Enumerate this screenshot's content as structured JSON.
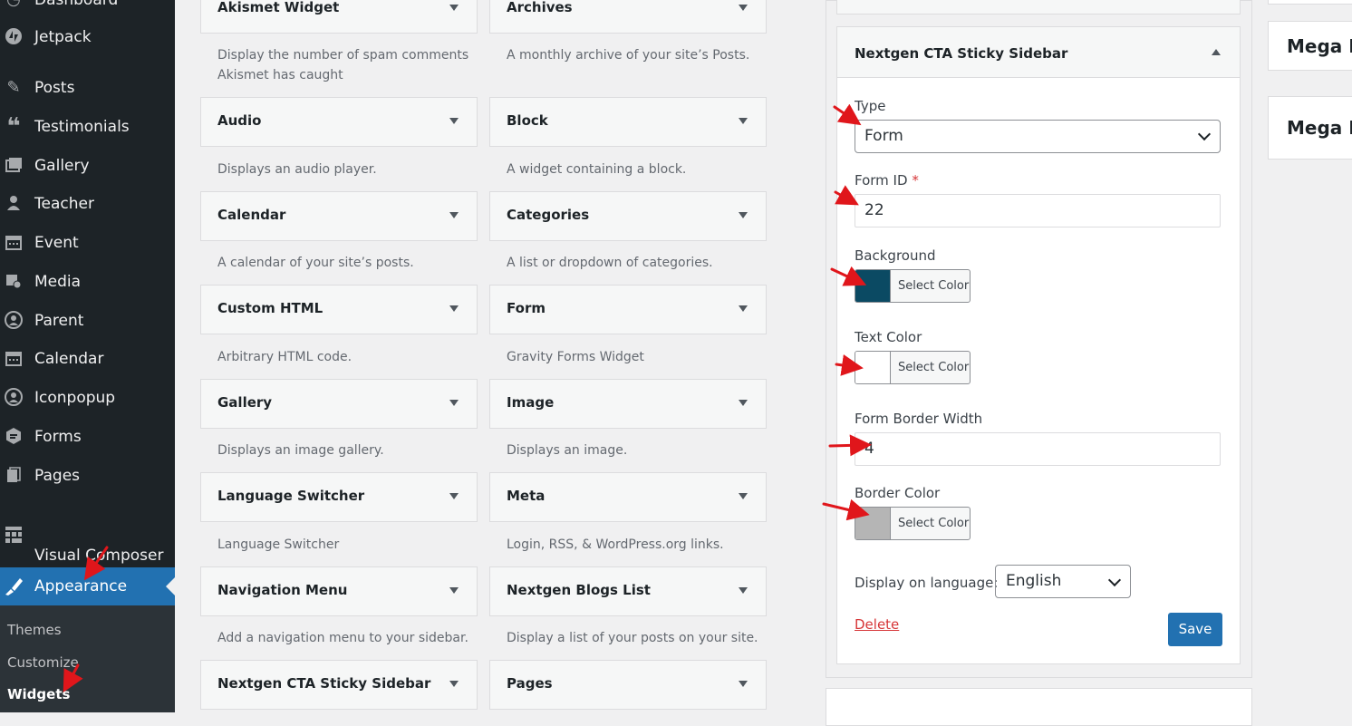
{
  "sidebar": {
    "items": [
      {
        "label": "Dashboard",
        "icon": "dashboard-icon"
      },
      {
        "label": "Jetpack",
        "icon": "jetpack-icon"
      },
      {
        "label": "Posts",
        "icon": "pin-icon"
      },
      {
        "label": "Testimonials",
        "icon": "quote-icon"
      },
      {
        "label": "Gallery",
        "icon": "gallery-icon"
      },
      {
        "label": "Teacher",
        "icon": "user-icon"
      },
      {
        "label": "Event",
        "icon": "calendar-icon"
      },
      {
        "label": "Media",
        "icon": "media-icon"
      },
      {
        "label": "Parent",
        "icon": "user-circle-icon"
      },
      {
        "label": "Calendar",
        "icon": "calendar-icon"
      },
      {
        "label": "Iconpopup",
        "icon": "user-circle-icon"
      },
      {
        "label": "Forms",
        "icon": "forms-icon"
      },
      {
        "label": "Pages",
        "icon": "pages-icon"
      },
      {
        "label": "Visual Composer\nContent",
        "icon": "grid-icon"
      },
      {
        "label": "Appearance",
        "icon": "brush-icon"
      }
    ],
    "submenu": [
      "Themes",
      "Customize",
      "Widgets"
    ]
  },
  "widgets": [
    {
      "title": "Akismet Widget",
      "desc": "Display the number of spam comments Akismet has caught"
    },
    {
      "title": "Archives",
      "desc": "A monthly archive of your site’s Posts."
    },
    {
      "title": "Audio",
      "desc": "Displays an audio player."
    },
    {
      "title": "Block",
      "desc": "A widget containing a block."
    },
    {
      "title": "Calendar",
      "desc": "A calendar of your site’s posts."
    },
    {
      "title": "Categories",
      "desc": "A list or dropdown of categories."
    },
    {
      "title": "Custom HTML",
      "desc": "Arbitrary HTML code."
    },
    {
      "title": "Form",
      "desc": "Gravity Forms Widget"
    },
    {
      "title": "Gallery",
      "desc": "Displays an image gallery."
    },
    {
      "title": "Image",
      "desc": "Displays an image."
    },
    {
      "title": "Language Switcher",
      "desc": "Language Switcher"
    },
    {
      "title": "Meta",
      "desc": "Login, RSS, & WordPress.org links."
    },
    {
      "title": "Navigation Menu",
      "desc": "Add a navigation menu to your sidebar."
    },
    {
      "title": "Nextgen Blogs List",
      "desc": "Display a list of your posts on your site."
    },
    {
      "title": "Nextgen CTA Sticky Sidebar",
      "desc": ""
    },
    {
      "title": "Pages",
      "desc": ""
    }
  ],
  "panel": {
    "title": "Nextgen CTA Sticky Sidebar",
    "type_label": "Type",
    "type_value": "Form",
    "form_id_label": "Form ID",
    "form_id_required": "*",
    "form_id_value": "22",
    "background_label": "Background",
    "background_color": "#0b4a63",
    "text_color_label": "Text Color",
    "text_color": "#ffffff",
    "border_width_label": "Form Border Width",
    "border_width_value": "4",
    "border_color_label": "Border Color",
    "border_color": "#b5b5b5",
    "select_color": "Select Color",
    "language_label": "Display on language:",
    "language_value": "English",
    "delete_label": "Delete",
    "save_label": "Save"
  },
  "right_sidebars": [
    "Mega M",
    "Mega M"
  ],
  "colors": {
    "sidebar_bg": "#1d2327",
    "accent": "#2271b1",
    "annotation_arrow": "#e0161b"
  }
}
